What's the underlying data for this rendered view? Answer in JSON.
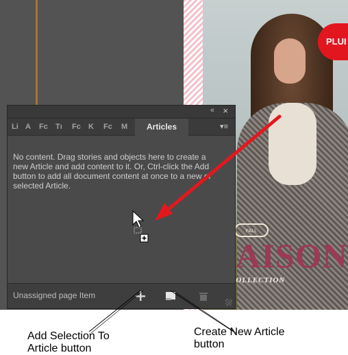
{
  "canvas": {
    "badge_text": "PLUI",
    "cover_small": "FALL",
    "cover_word": "MAISON",
    "cover_sub": "COLLECTION"
  },
  "panel": {
    "collapse_icon": "«",
    "close_icon": "×",
    "tabs": [
      "Li",
      "A",
      "Fc",
      "Tı",
      "Fc",
      "K",
      "Fc",
      "M"
    ],
    "active_tab": "Articles",
    "panel_menu_icon": "▾≡",
    "empty_message": "No content. Drag stories and objects here to create a new Article and add content to it. Or, Ctrl-click the Add button to add all document content at once to a new or selected Article.",
    "footer_label": "Unassigned page Item",
    "buttons": {
      "add": "add-selection-to-article-button",
      "new": "create-new-article-button",
      "delete": "delete-button"
    }
  },
  "callouts": {
    "add_label_line1": "Add Selection To",
    "add_label_line2": "Article button",
    "create_label_line1": "Create New Article",
    "create_label_line2": "button"
  },
  "colors": {
    "panel_bg": "#4a4a4a",
    "arrow": "#e3181f",
    "badge": "#e2161f"
  }
}
